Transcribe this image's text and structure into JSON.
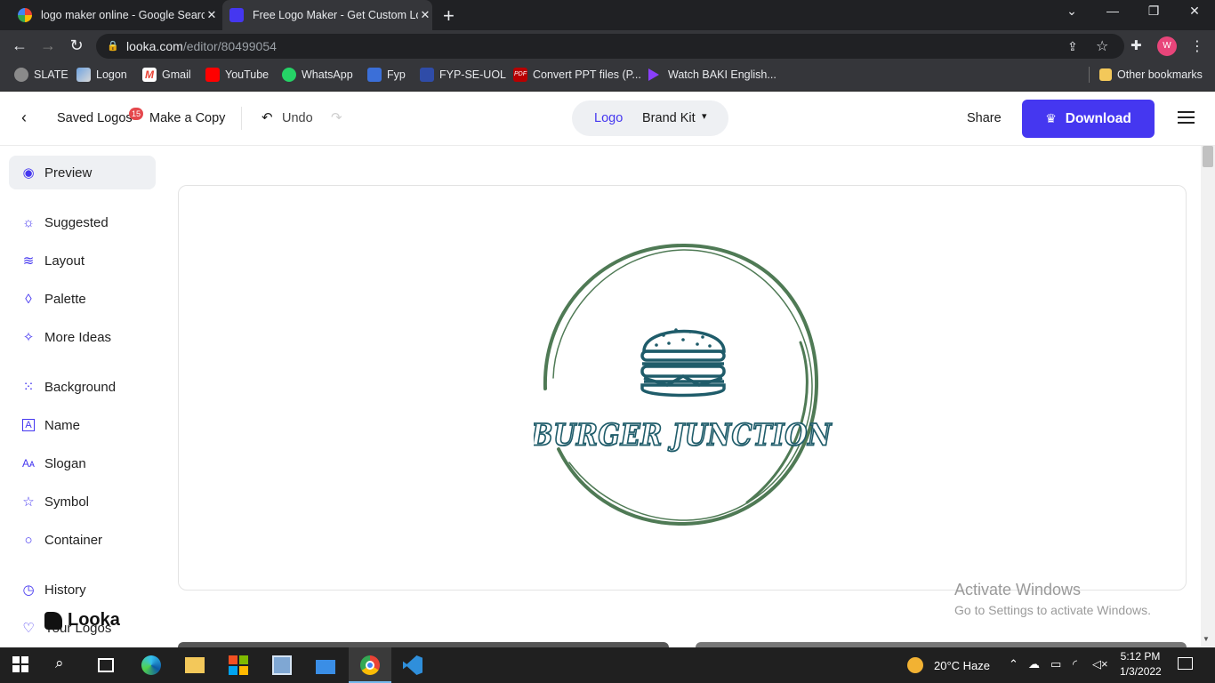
{
  "browser": {
    "tabs": [
      {
        "title": "logo maker online - Google Search",
        "close": "✕"
      },
      {
        "title": "Free Logo Maker - Get Custom Logo Designs",
        "close": "✕"
      }
    ],
    "new_tab": "+",
    "url_domain": "looka.com",
    "url_path": "/editor/80499054",
    "profile_initial": "W",
    "bookmarks": [
      "SLATE",
      "Logon",
      "Gmail",
      "YouTube",
      "WhatsApp",
      "Fyp",
      "FYP-SE-UOL",
      "Convert PPT files (P...",
      "Watch BAKI English..."
    ],
    "other_bookmarks": "Other bookmarks"
  },
  "header": {
    "saved_logos": "Saved Logos",
    "saved_count": "15",
    "make_copy": "Make a Copy",
    "undo": "Undo",
    "seg_logo": "Logo",
    "seg_brand_kit": "Brand Kit",
    "share": "Share",
    "download": "Download"
  },
  "sidebar": {
    "items": [
      {
        "label": "Preview",
        "icon": "eye-icon"
      },
      {
        "label": "Suggested",
        "icon": "lightbulb-icon"
      },
      {
        "label": "Layout",
        "icon": "layers-icon"
      },
      {
        "label": "Palette",
        "icon": "drop-icon"
      },
      {
        "label": "More Ideas",
        "icon": "magic-wand-icon"
      },
      {
        "label": "Background",
        "icon": "background-icon"
      },
      {
        "label": "Name",
        "icon": "name-icon"
      },
      {
        "label": "Slogan",
        "icon": "slogan-icon"
      },
      {
        "label": "Symbol",
        "icon": "star-icon"
      },
      {
        "label": "Container",
        "icon": "circle-icon"
      },
      {
        "label": "History",
        "icon": "history-icon"
      },
      {
        "label": "Your Logos",
        "icon": "heart-icon"
      }
    ],
    "brand": "Looka"
  },
  "logo": {
    "name": "BURGER JUNCTION",
    "primary_color": "#1f5c6a",
    "ring_color": "#4f7a55"
  },
  "watermark": {
    "line1": "Activate Windows",
    "line2": "Go to Settings to activate Windows."
  },
  "taskbar": {
    "weather": "20°C  Haze",
    "time": "5:12 PM",
    "date": "1/3/2022"
  },
  "colors": {
    "accent": "#4537f0",
    "badge": "#e5484d"
  }
}
